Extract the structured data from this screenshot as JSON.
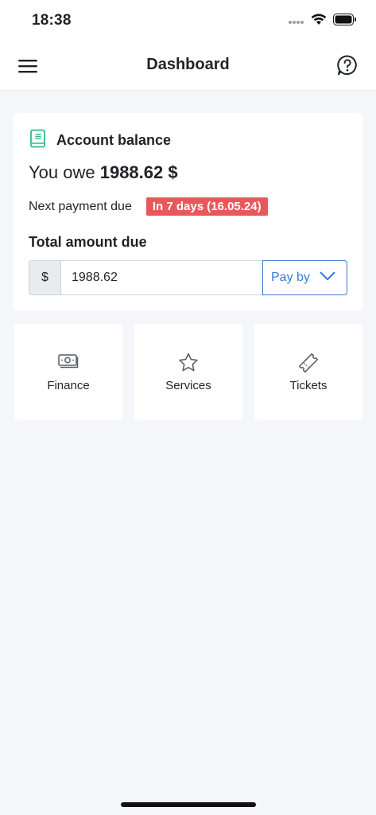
{
  "status_bar": {
    "time": "18:38"
  },
  "header": {
    "title": "Dashboard"
  },
  "account_card": {
    "title": "Account balance",
    "owe_prefix": "You owe ",
    "owe_amount": "1988.62 $",
    "next_payment_label": "Next payment due",
    "due_badge": "In 7 days (16.05.24)",
    "total_label": "Total amount due",
    "currency_symbol": "$",
    "amount_value": "1988.62",
    "pay_by_label": "Pay by"
  },
  "tiles": [
    {
      "label": "Finance",
      "icon": "cash-icon"
    },
    {
      "label": "Services",
      "icon": "star-icon"
    },
    {
      "label": "Tickets",
      "icon": "ticket-icon"
    }
  ],
  "colors": {
    "accent": "#3a7bd5",
    "danger": "#e8585b",
    "ledger_icon": "#2bbf8a",
    "background": "#f5f6fa"
  }
}
